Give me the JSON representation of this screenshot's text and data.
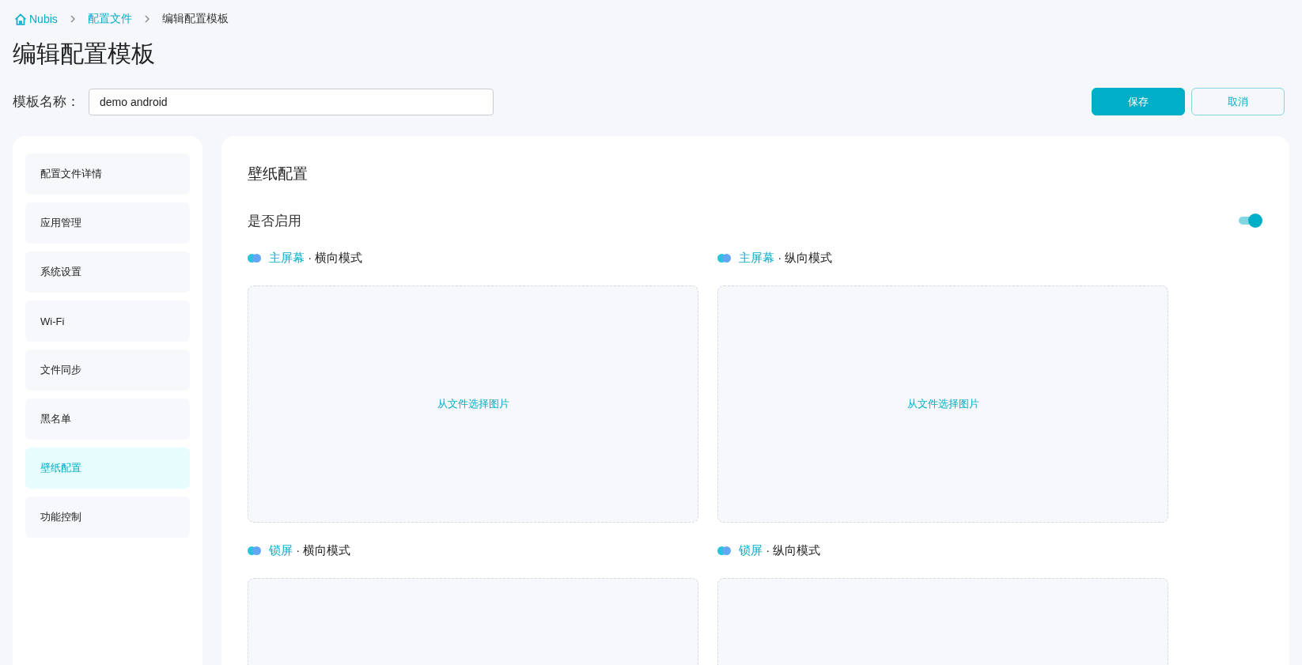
{
  "breadcrumb": [
    {
      "label": "Nubis",
      "kind": "home"
    },
    {
      "label": "配置文件",
      "kind": "link"
    },
    {
      "label": "编辑配置模板",
      "kind": "current"
    }
  ],
  "page_title": "编辑配置模板",
  "template_name": {
    "label": "模板名称：",
    "value": "demo android"
  },
  "buttons": [
    {
      "label": "保存",
      "kind": "primary"
    },
    {
      "label": "取消",
      "kind": "secondary"
    }
  ],
  "sidebar": {
    "items": [
      {
        "label": "配置文件详情",
        "selected": false
      },
      {
        "label": "应用管理",
        "selected": false
      },
      {
        "label": "系统设置",
        "selected": false
      },
      {
        "label": "Wi-Fi",
        "selected": false
      },
      {
        "label": "文件同步",
        "selected": false
      },
      {
        "label": "黑名单",
        "selected": false
      },
      {
        "label": "壁纸配置",
        "selected": true
      },
      {
        "label": "功能控制",
        "selected": false
      }
    ]
  },
  "section": {
    "title": "壁纸配置",
    "enable": {
      "label": "是否启用",
      "on": true
    },
    "wallpapers": [
      {
        "screen": "主屏幕",
        "separator": "·",
        "mode": "横向模式",
        "prompt": "从文件选择图片"
      },
      {
        "screen": "主屏幕",
        "separator": "·",
        "mode": "纵向模式",
        "prompt": "从文件选择图片"
      },
      {
        "screen": "锁屏",
        "separator": "·",
        "mode": "横向模式"
      },
      {
        "screen": "锁屏",
        "separator": "·",
        "mode": "纵向模式"
      }
    ]
  }
}
